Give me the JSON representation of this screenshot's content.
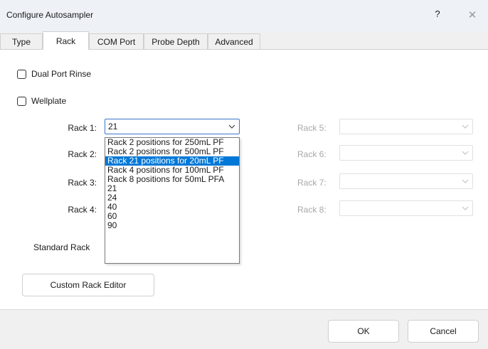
{
  "window": {
    "title": "Configure Autosampler",
    "help_label": "?",
    "close_label": "✕"
  },
  "tabs": [
    {
      "label": "Type",
      "active": false
    },
    {
      "label": "Rack",
      "active": true
    },
    {
      "label": "COM Port",
      "active": false
    },
    {
      "label": "Probe Depth",
      "active": false
    },
    {
      "label": "Advanced",
      "active": false
    }
  ],
  "options": {
    "dual_port_rinse": {
      "label": "Dual Port Rinse",
      "checked": false
    },
    "wellplate": {
      "label": "Wellplate",
      "checked": false
    }
  },
  "racks_left": [
    {
      "label": "Rack 1:",
      "value": "21"
    },
    {
      "label": "Rack 2:",
      "value": ""
    },
    {
      "label": "Rack 3:",
      "value": ""
    },
    {
      "label": "Rack 4:",
      "value": ""
    }
  ],
  "racks_right": [
    {
      "label": "Rack 5:",
      "value": ""
    },
    {
      "label": "Rack 6:",
      "value": ""
    },
    {
      "label": "Rack 7:",
      "value": ""
    },
    {
      "label": "Rack 8:",
      "value": ""
    }
  ],
  "rack1_dropdown": {
    "options": [
      "Rack 2 positions for 250mL PF",
      "Rack 2 positions for 500mL PF",
      "Rack 21 positions for 20mL PF",
      "Rack 4 positions for 100mL PF",
      "Rack 8 positions for 50mL PFA",
      "21",
      "24",
      "40",
      "60",
      "90"
    ],
    "selected_index": 2
  },
  "standard_rack_label": "Standard Rack",
  "custom_rack_editor_label": "Custom Rack Editor",
  "footer": {
    "ok_label": "OK",
    "cancel_label": "Cancel"
  },
  "icons": {
    "checkbox": "checkbox-unchecked-icon",
    "dropdown_arrow": "chevron-down-icon",
    "close": "close-icon",
    "help": "help-icon"
  },
  "colors": {
    "selection": "#0078d7",
    "focus_border": "#3a76c9",
    "disabled_text": "#a8a8a8"
  }
}
